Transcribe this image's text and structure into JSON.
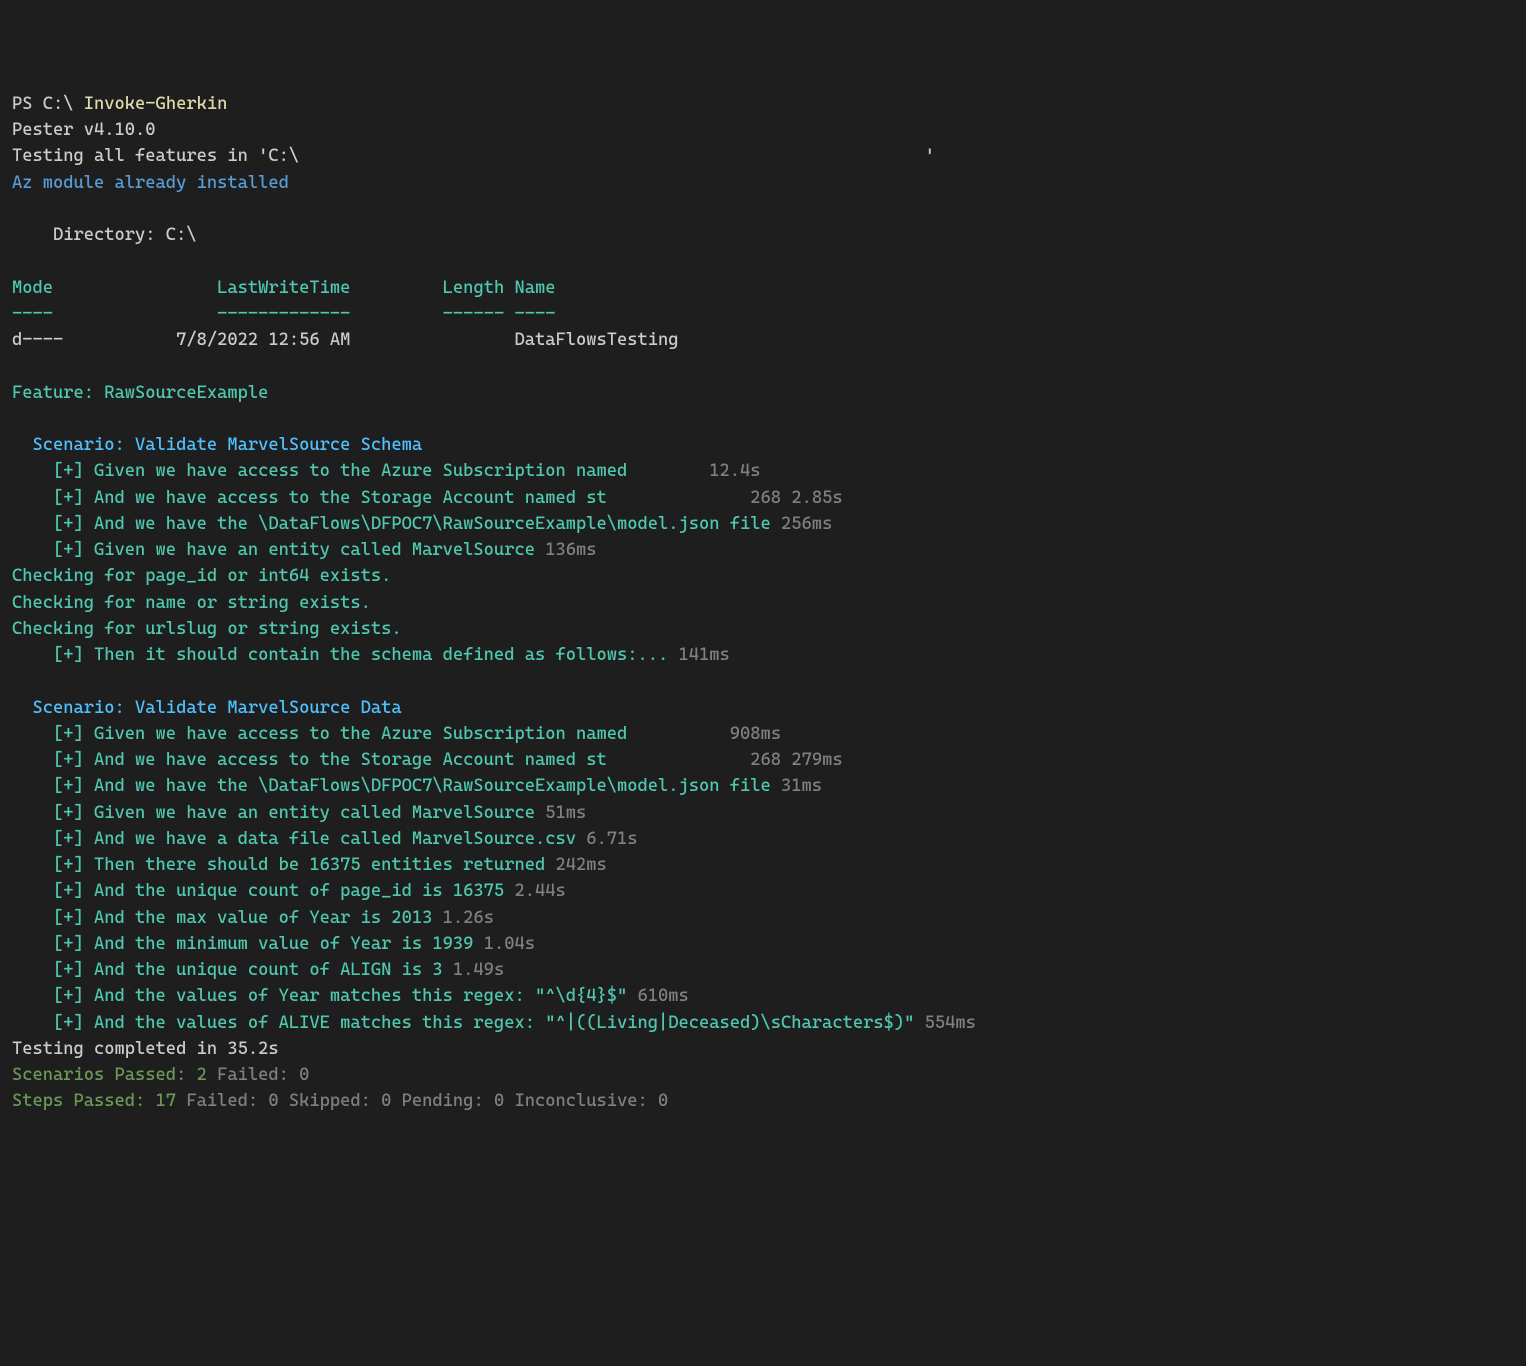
{
  "prompt": "PS C:\\ ",
  "command": "Invoke-Gherkin",
  "pester_version": "Pester v4.10.0",
  "testing_line_pre": "Testing all features in 'C:\\",
  "testing_line_post": "'",
  "az_installed": "Az module already installed",
  "directory_line": "    Directory: C:\\",
  "headers": {
    "mode": "Mode",
    "lwt": "LastWriteTime",
    "length": "Length",
    "name": "Name"
  },
  "header_dashes": {
    "mode": "----",
    "lwt": "-------------",
    "length": "------",
    "name": "----"
  },
  "dir_entry": {
    "mode": "d----",
    "date": "7/8/2022 12:56 AM",
    "name": "DataFlowsTesting"
  },
  "feature": "Feature: RawSourceExample",
  "scenario1": {
    "title": "  Scenario: Validate MarvelSource Schema",
    "steps": [
      {
        "text": "    [+] Given we have access to the Azure Subscription named ",
        "time": "12.4s",
        "pad": "       "
      },
      {
        "text": "    [+] And we have access to the Storage Account named st",
        "time": "268 2.85s",
        "pad": "              "
      },
      {
        "text": "    [+] And we have the \\DataFlows\\DFPOC7\\RawSourceExample\\model.json file ",
        "time": "256ms",
        "pad": ""
      },
      {
        "text": "    [+] Given we have an entity called MarvelSource ",
        "time": "136ms",
        "pad": ""
      }
    ],
    "checks": [
      "Checking for page_id or int64 exists.",
      "Checking for name or string exists.",
      "Checking for urlslug or string exists."
    ],
    "step_then": {
      "text": "    [+] Then it should contain the schema defined as follows:... ",
      "time": "141ms"
    }
  },
  "scenario2": {
    "title": "  Scenario: Validate MarvelSource Data",
    "steps": [
      {
        "text": "    [+] Given we have access to the Azure Subscription named ",
        "time": "908ms",
        "pad": "         "
      },
      {
        "text": "    [+] And we have access to the Storage Account named st",
        "time": "268 279ms",
        "pad": "              "
      },
      {
        "text": "    [+] And we have the \\DataFlows\\DFPOC7\\RawSourceExample\\model.json file ",
        "time": "31ms",
        "pad": ""
      },
      {
        "text": "    [+] Given we have an entity called MarvelSource ",
        "time": "51ms",
        "pad": ""
      },
      {
        "text": "    [+] And we have a data file called MarvelSource.csv ",
        "time": "6.71s",
        "pad": ""
      },
      {
        "text": "    [+] Then there should be 16375 entities returned ",
        "time": "242ms",
        "pad": ""
      },
      {
        "text": "    [+] And the unique count of page_id is 16375 ",
        "time": "2.44s",
        "pad": ""
      },
      {
        "text": "    [+] And the max value of Year is 2013 ",
        "time": "1.26s",
        "pad": ""
      },
      {
        "text": "    [+] And the minimum value of Year is 1939 ",
        "time": "1.04s",
        "pad": ""
      },
      {
        "text": "    [+] And the unique count of ALIGN is 3 ",
        "time": "1.49s",
        "pad": ""
      },
      {
        "text": "    [+] And the values of Year matches this regex: \"^\\d{4}$\" ",
        "time": "610ms",
        "pad": ""
      },
      {
        "text": "    [+] And the values of ALIVE matches this regex: \"^|((Living|Deceased)\\sCharacters$)\" ",
        "time": "554ms",
        "pad": ""
      }
    ]
  },
  "summary": {
    "completed": "Testing completed in 35.2s",
    "scenarios_passed": "Scenarios Passed: 2 ",
    "scenarios_failed": "Failed: 0",
    "steps_passed": "Steps Passed: 17 ",
    "steps_failed": "Failed: 0 Skipped: 0 Pending: 0 Inconclusive: 0"
  }
}
